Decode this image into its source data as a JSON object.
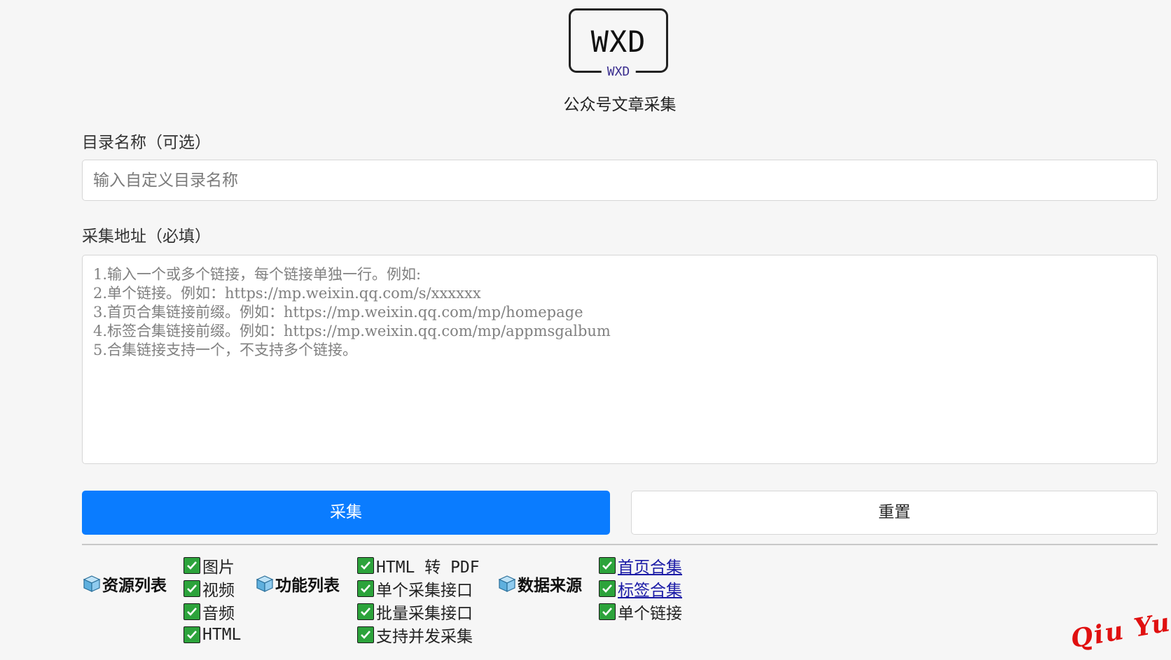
{
  "logo": {
    "main": "WXD",
    "sub": "WXD"
  },
  "header": {
    "subtitle": "公众号文章采集"
  },
  "form": {
    "dir_label": "目录名称（可选）",
    "dir_placeholder": "输入自定义目录名称",
    "url_label": "采集地址（必填）",
    "url_placeholder": "1.输入一个或多个链接，每个链接单独一行。例如:\n2.单个链接。例如：https://mp.weixin.qq.com/s/xxxxxx\n3.首页合集链接前缀。例如：https://mp.weixin.qq.com/mp/homepage\n4.标签合集链接前缀。例如：https://mp.weixin.qq.com/mp/appmsgalbum\n5.合集链接支持一个，不支持多个链接。"
  },
  "buttons": {
    "collect": "采集",
    "reset": "重置"
  },
  "sections": {
    "resources": {
      "title": "资源列表",
      "items": [
        "图片",
        "视频",
        "音频",
        "HTML"
      ]
    },
    "features": {
      "title": "功能列表",
      "items": [
        "HTML 转 PDF",
        "单个采集接口",
        "批量采集接口",
        "支持并发采集"
      ]
    },
    "sources": {
      "title": "数据来源",
      "items": [
        "首页合集",
        "标签合集",
        "单个链接"
      ]
    }
  },
  "watermark": "Qiu Yue",
  "colors": {
    "primary": "#0a7cff",
    "check": "#2ca33b",
    "watermark": "#e01010",
    "link": "#1a1aa6"
  }
}
